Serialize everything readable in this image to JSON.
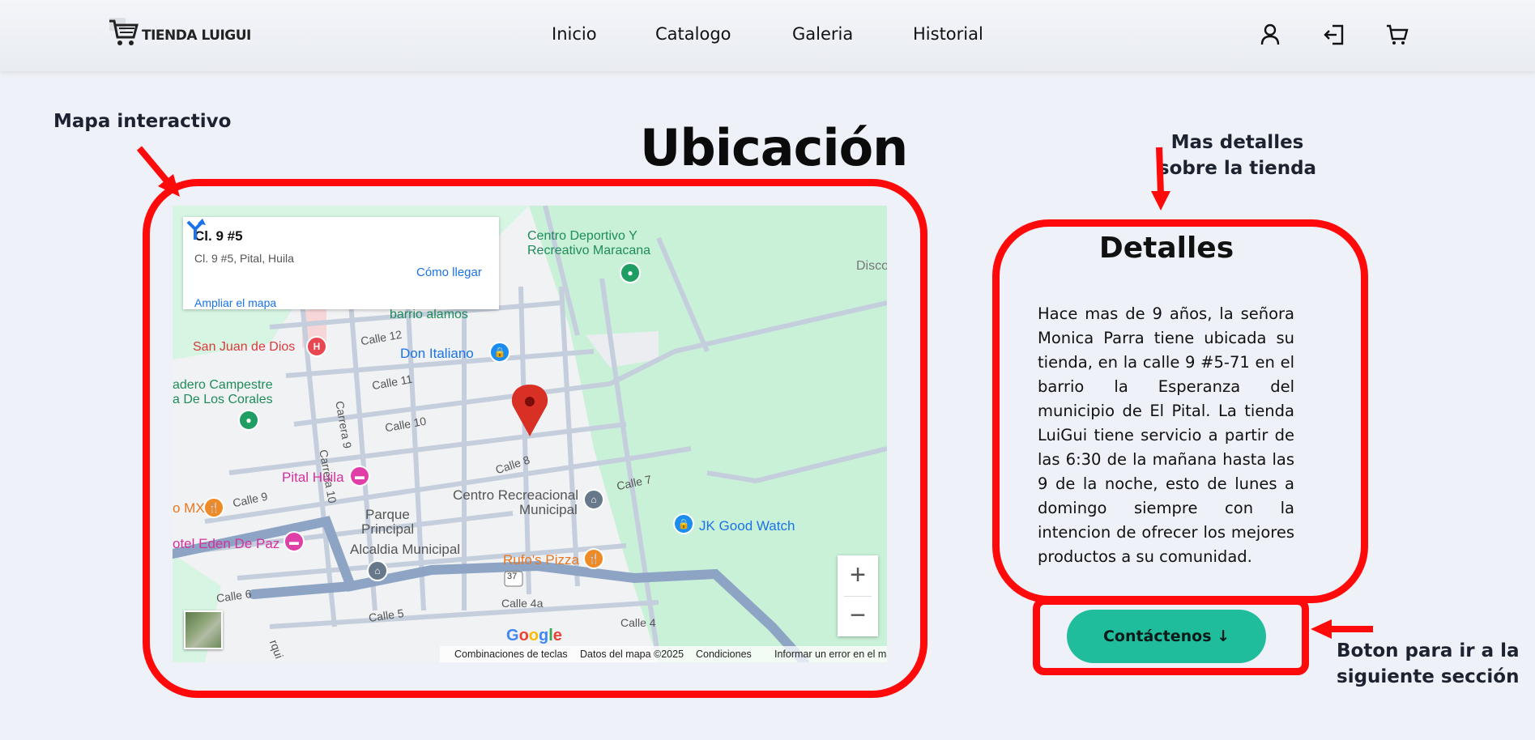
{
  "header": {
    "logo_text": "TIENDA LUIGUI",
    "nav": [
      "Inicio",
      "Catalogo",
      "Galeria",
      "Historial"
    ],
    "icons": [
      "user-icon",
      "logout-icon",
      "cart-icon"
    ]
  },
  "annotations": {
    "map": "Mapa interactivo",
    "details_line1": "Mas detalles",
    "details_line2": "sobre la tienda",
    "button_line1": "Boton para ir a la",
    "button_line2": "siguiente sección"
  },
  "section_title": "Ubicación",
  "map": {
    "card_title": "Cl. 9 #5",
    "card_address": "Cl. 9 #5, Pital, Huila",
    "directions_label": "Cómo llegar",
    "expand_link": "Ampliar el mapa",
    "places": {
      "sports": "Centro Deportivo Y",
      "sports2": "Recreativo Maracana",
      "disco": "Disco",
      "alamos": "barrio alamos",
      "sanjuan": "San Juan de Dios",
      "italiano": "Don Italiano",
      "campestre": "adero Campestre",
      "corales": "a De Los Corales",
      "pital": "Pital Huila",
      "mx": "o MX",
      "eden": "otel Eden De Paz",
      "parque1": "Parque",
      "parque2": "Principal",
      "alcaldia": "Alcaldia Municipal",
      "centro1": "Centro Recreacional",
      "centro2": "Municipal",
      "jk": "JK Good Watch",
      "rufos": "Rufo's Pizza"
    },
    "streets": {
      "calle12": "Calle 12",
      "calle11": "Calle 11",
      "calle10": "Calle 10",
      "calle9": "Calle 9",
      "calle8": "Calle 8",
      "calle7": "Calle 7",
      "calle6": "Calle 6",
      "calle5": "Calle 5",
      "calle4a": "Calle 4a",
      "calle4": "Calle 4",
      "carrera9": "Carrera 9",
      "carrera10": "Carrera 10",
      "route": "37",
      "pital_edge": "rqui"
    },
    "zoom_in": "+",
    "zoom_out": "−",
    "google": "Google",
    "footer": [
      "Combinaciones de teclas",
      "Datos del mapa ©2025",
      "Condiciones",
      "Informar un error en el mapa"
    ],
    "colors": {
      "park": "#c8f0d8",
      "road": "#c5cedc",
      "main_road": "#8da4c4",
      "pin": "#d93025"
    }
  },
  "details": {
    "title": "Detalles",
    "text": "Hace mas de 9 años, la señora Monica Parra tiene ubicada su tienda, en la calle 9 #5-71 en el barrio la Esperanza del municipio de El Pital. La tienda LuiGui tiene servicio a partir de las 6:30 de la mañana hasta las 9 de la noche, esto de lunes a domingo siempre con la intencion de ofrecer los mejores productos a su comunidad."
  },
  "contact_button": "Contáctenos ↓",
  "accent": "#1fbd9c",
  "annotation_red": "#ff0a0a"
}
